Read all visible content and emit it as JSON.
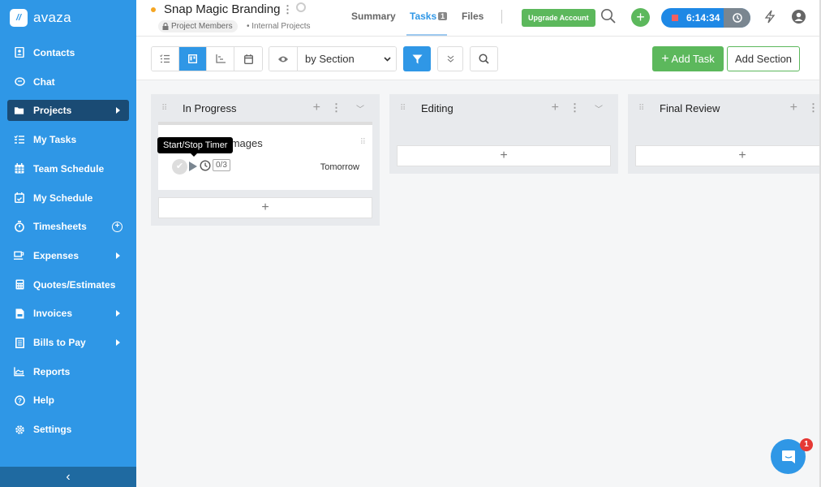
{
  "app": {
    "logo_text": "avaza",
    "logo_mark": "//"
  },
  "sidebar": {
    "items": [
      {
        "label": "Contacts",
        "icon": "contacts-icon"
      },
      {
        "label": "Chat",
        "icon": "chat-icon"
      },
      {
        "label": "Projects",
        "icon": "folder-icon",
        "active": true,
        "submenu": true
      },
      {
        "label": "My Tasks",
        "icon": "tasks-icon"
      },
      {
        "label": "Team Schedule",
        "icon": "calendar-icon"
      },
      {
        "label": "My Schedule",
        "icon": "calendar-check-icon"
      },
      {
        "label": "Timesheets",
        "icon": "stopwatch-icon",
        "add": true
      },
      {
        "label": "Expenses",
        "icon": "cup-icon",
        "submenu": true
      },
      {
        "label": "Quotes/Estimates",
        "icon": "calculator-icon"
      },
      {
        "label": "Invoices",
        "icon": "invoice-icon",
        "submenu": true
      },
      {
        "label": "Bills to Pay",
        "icon": "bill-icon",
        "submenu": true
      },
      {
        "label": "Reports",
        "icon": "chart-icon"
      },
      {
        "label": "Help",
        "icon": "help-icon"
      },
      {
        "label": "Settings",
        "icon": "gear-icon"
      }
    ],
    "collapse_glyph": "‹"
  },
  "header": {
    "project_title": "Snap Magic Branding",
    "visibility": "Project Members",
    "category": "Internal Projects",
    "tabs": [
      {
        "label": "Summary",
        "active": false
      },
      {
        "label": "Tasks",
        "active": true,
        "badge": "1"
      },
      {
        "label": "Files",
        "active": false
      }
    ],
    "upgrade_label": "Upgrade Account",
    "timer_value": "6:14:34",
    "status_color": "#f5a623",
    "accent_color": "#2f97e6"
  },
  "toolbar": {
    "group_by": "by Section",
    "add_task_label": "Add Task",
    "add_section_label": "Add Section"
  },
  "board": {
    "columns": [
      {
        "title": "In Progress",
        "tasks": [
          {
            "title": "Design Images",
            "visible_title": "gn Images",
            "due": "Tomorrow",
            "subtasks": "0/3"
          }
        ]
      },
      {
        "title": "Editing",
        "tasks": []
      },
      {
        "title": "Final Review",
        "tasks": []
      }
    ]
  },
  "tooltip": {
    "text": "Start/Stop Timer"
  },
  "chat_widget": {
    "badge": "1"
  }
}
